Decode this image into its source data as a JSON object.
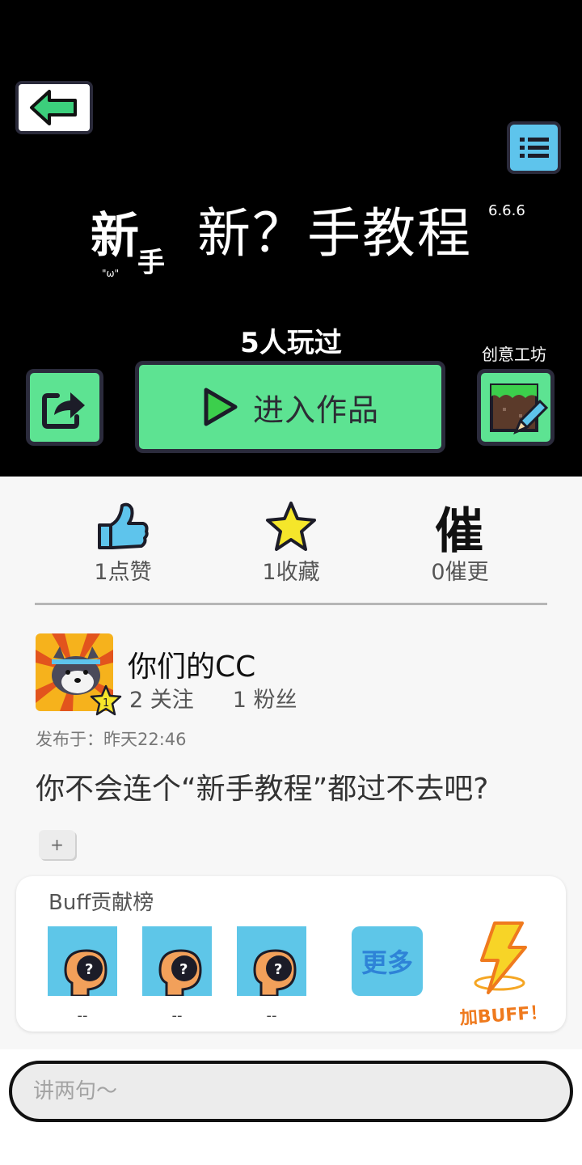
{
  "header": {
    "title": "新？手教程",
    "version": "6.6.6",
    "played_label": "5人玩过",
    "enter_label": "进入作品",
    "workshop_label": "创意工坊",
    "logo_text": "新手"
  },
  "stats": [
    {
      "icon": "thumbs-up-icon",
      "label": "1点赞"
    },
    {
      "icon": "star-icon",
      "label": "1收藏"
    },
    {
      "icon": "urge-icon",
      "label": "0催更",
      "glyph": "催"
    }
  ],
  "author": {
    "name": "你们的CC",
    "level": "1",
    "following": "2 关注",
    "followers": "1 粉丝",
    "published": "发布于：昨天22:46"
  },
  "description": "你不会连个“新手教程”都过不去吧?",
  "plus_label": "+",
  "buff": {
    "title": "Buff贡献榜",
    "contributors": [
      {
        "name": "--"
      },
      {
        "name": "--"
      },
      {
        "name": "--"
      }
    ],
    "more_label": "更多",
    "add_label": "加BUFF！"
  },
  "comment": {
    "placeholder": "讲两句～"
  },
  "colors": {
    "accent_green": "#5de392",
    "accent_blue": "#5ec4ec",
    "header_bg": "#000000"
  }
}
